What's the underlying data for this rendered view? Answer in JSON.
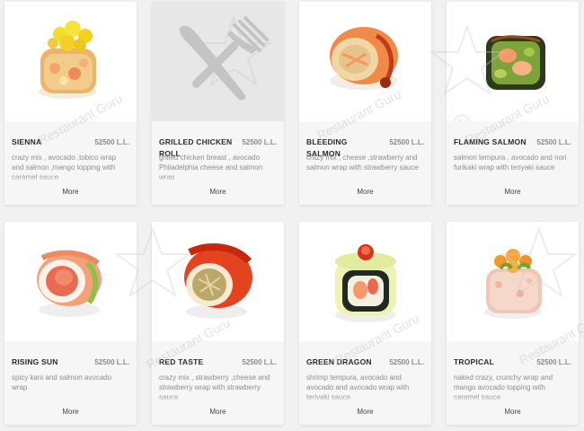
{
  "watermark_text": "Restaurant Guru",
  "items": [
    {
      "name": "SIENNA",
      "price": "52500 L.L.",
      "description": "crazy mix , avocado ,tobico wrap and salmon ,mango topping with caramel sauce",
      "more": "More",
      "image": "sushi-roll-image"
    },
    {
      "name": "GRILLED CHICKEN ROLL",
      "price": "52500 L.L.",
      "description": "grilled chicken breast , avocado Philadelphia cheese and salmon wrap",
      "more": "More",
      "image": "fork-knife-placeholder-icon"
    },
    {
      "name": "BLEEDING SALMON",
      "price": "52500 L.L.",
      "description": "crazy mix , cheese ,strawberry and salmon wrap with strawberry sauce",
      "more": "More",
      "image": "sushi-roll-image"
    },
    {
      "name": "FLAMING SALMON",
      "price": "52500 L.L.",
      "description": "salmon tempura , avocado and nori furikaki wrap with teriyaki sauce",
      "more": "More",
      "image": "sushi-roll-image"
    },
    {
      "name": "RISING SUN",
      "price": "52500 L.L.",
      "description": "spicy kani and salmon avocado wrap",
      "more": "More",
      "image": "sushi-roll-image"
    },
    {
      "name": "RED TASTE",
      "price": "52500 L.L.",
      "description": "crazy mix , strawberry ,cheese and strawberry wrap with strawberry sauce",
      "more": "More",
      "image": "sushi-roll-image"
    },
    {
      "name": "GREEN DRAGON",
      "price": "52500 L.L.",
      "description": "shrimp tempura, avocado and avocado and avocado wrap with teriyaki sauce",
      "more": "More",
      "image": "sushi-roll-image"
    },
    {
      "name": "TROPICAL",
      "price": "52500 L.L.",
      "description": "naked crazy, crunchy wrap and mango avocado topping with caramel sauce",
      "more": "More",
      "image": "sushi-roll-image"
    }
  ]
}
